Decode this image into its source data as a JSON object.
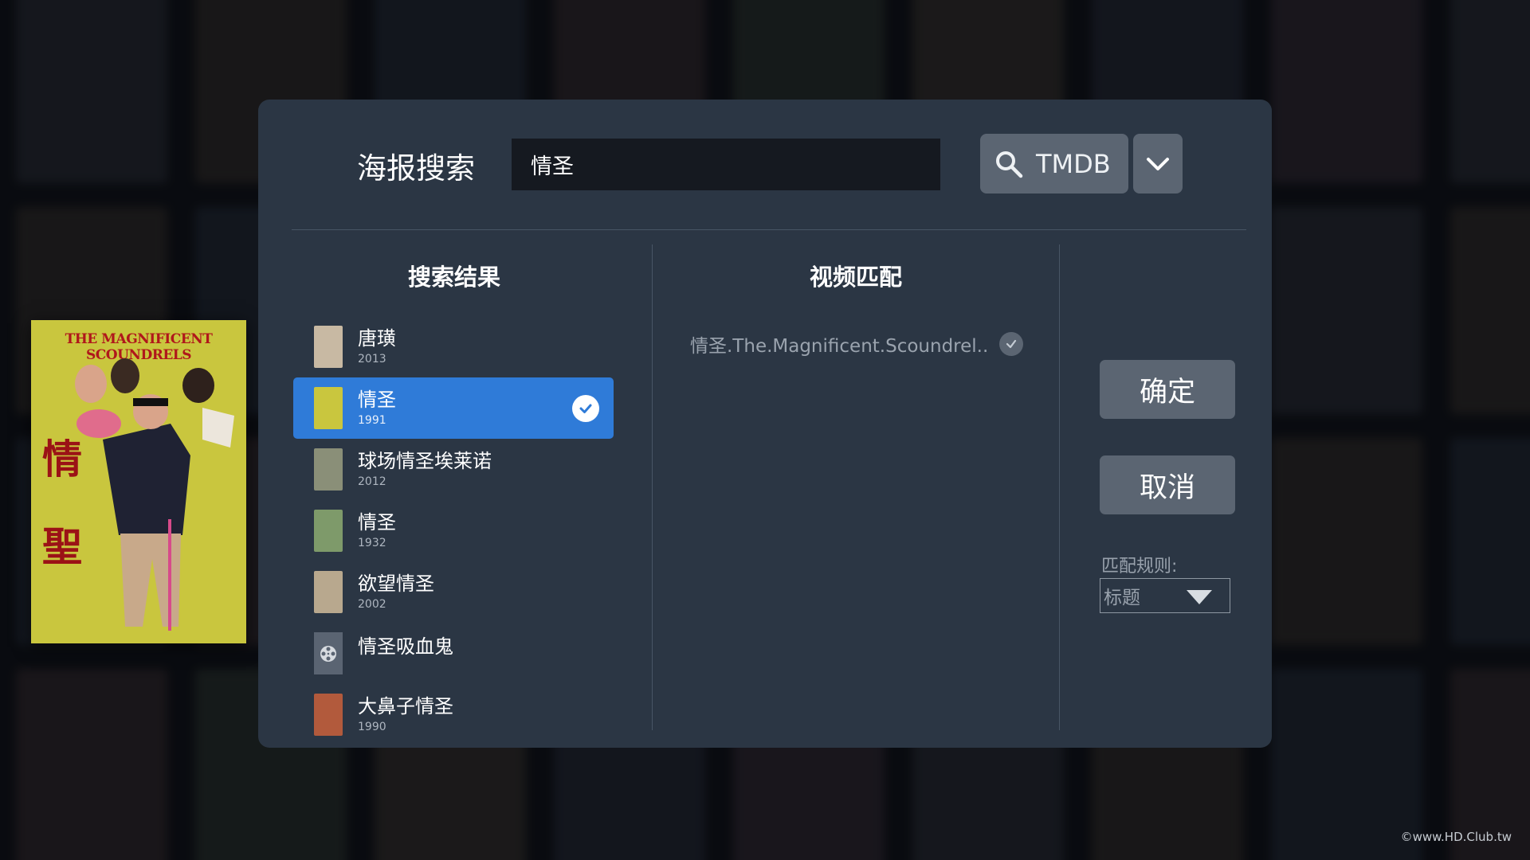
{
  "dialog": {
    "title": "海报搜索",
    "search_value": "情圣",
    "source_label": "TMDB",
    "results_header": "搜索结果",
    "match_header": "视频匹配"
  },
  "results": [
    {
      "title": "唐璜",
      "year": "2013",
      "selected": false,
      "thumb_color": "#c8b9a3"
    },
    {
      "title": "情圣",
      "year": "1991",
      "selected": true,
      "thumb_color": "#c9c63e"
    },
    {
      "title": "球场情圣埃莱诺",
      "year": "2012",
      "selected": false,
      "thumb_color": "#8a8f78"
    },
    {
      "title": "情圣",
      "year": "1932",
      "selected": false,
      "thumb_color": "#7e9a6a"
    },
    {
      "title": "欲望情圣",
      "year": "2002",
      "selected": false,
      "thumb_color": "#b8a88e"
    },
    {
      "title": "情圣吸血鬼",
      "year": "",
      "selected": false,
      "thumb_color": ""
    },
    {
      "title": "大鼻子情圣",
      "year": "1990",
      "selected": false,
      "thumb_color": "#b25a3c"
    }
  ],
  "match": {
    "filename": "情圣.The.Magnificent.Scoundrel.."
  },
  "buttons": {
    "confirm": "确定",
    "cancel": "取消"
  },
  "rule": {
    "label": "匹配规则:",
    "value": "标题"
  },
  "poster": {
    "title_text": "THE MAGNIFICENT SCOUNDRELS",
    "cn_text": "情聖"
  },
  "watermark": "©www.HD.Club.tw",
  "colors": {
    "dialog_bg": "#2b3644",
    "selected_bg": "#2f7bd8",
    "button_bg": "#5b6572"
  }
}
